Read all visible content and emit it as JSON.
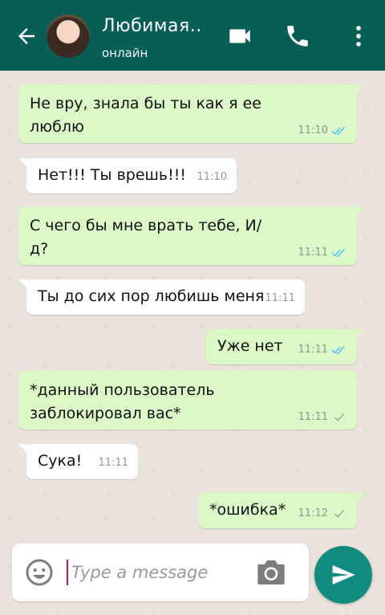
{
  "header": {
    "title": "Любимая..",
    "status": "онлайн",
    "bg_color": "#075e54"
  },
  "messages": [
    {
      "dir": "out",
      "text_lines": [
        "Не вру, знала бы ты как я ее",
        "люблю"
      ],
      "time": "11:10",
      "ticks": "read"
    },
    {
      "dir": "in",
      "text_lines": [
        "Нет!!! Ты врешь!!!"
      ],
      "time": "11:10"
    },
    {
      "dir": "out",
      "text_lines": [
        "С чего бы мне врать тебе, И/",
        "д?"
      ],
      "time": "11:11",
      "ticks": "read"
    },
    {
      "dir": "in",
      "text_lines": [
        "Ты до сих пор любишь меня"
      ],
      "time": "11:11"
    },
    {
      "dir": "out",
      "text_lines": [
        "Уже нет"
      ],
      "time": "11:11",
      "ticks": "read"
    },
    {
      "dir": "out",
      "text_lines": [
        "*данный пользователь",
        "заблокировал вас*"
      ],
      "time": "11:11",
      "ticks": "sent"
    },
    {
      "dir": "in",
      "text_lines": [
        "Сука!"
      ],
      "time": "11:11"
    },
    {
      "dir": "out",
      "text_lines": [
        "*ошибка*"
      ],
      "time": "11:12",
      "ticks": "sent"
    }
  ],
  "composer": {
    "placeholder": "Type a message"
  },
  "icons": {
    "back": "arrow-back-icon",
    "video": "video-camera-icon",
    "call": "phone-icon",
    "more": "more-vert-icon",
    "emoji": "emoji-icon",
    "camera": "camera-icon",
    "send": "send-icon"
  },
  "colors": {
    "outgoing": "#dcf8c6",
    "incoming": "#ffffff",
    "read_tick": "#4fc3f7",
    "send_button": "#128c7e"
  }
}
